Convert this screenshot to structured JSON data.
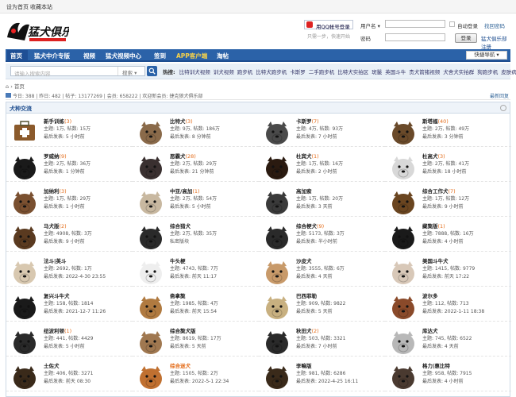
{
  "topbar": {
    "set_home": "设为首页",
    "bookmark": "收藏本站"
  },
  "header": {
    "logo_text": "猛犬俱乐部",
    "qq_login": "用QQ帐号登录",
    "qq_sub": "只需一步，快速开始",
    "username_label": "用户名",
    "password_label": "密码",
    "auto_login": "自动登录",
    "forgot": "找回密码",
    "login_btn": "登录",
    "register": "猛犬俱乐部注册"
  },
  "nav": {
    "items": [
      "首页",
      "猛犬中介专版",
      "视频",
      "猛犬视频中心",
      "签到",
      "APP客户端",
      "淘帖"
    ],
    "quick": "快捷导航"
  },
  "search": {
    "placeholder": "请输入搜索内容",
    "scope": "搜索",
    "hot_label": "热搜:",
    "hot": [
      "比特训犬视频",
      "训犬视频",
      "跑步机",
      "比特犬跑步机",
      "卡斯罗",
      "二手跑步机",
      "比特犬实拍区",
      "斑鬣",
      "英国斗牛",
      "贵犬箭猪视频",
      "犬舍犬实拍群",
      "狗跑步机",
      "皮肤病"
    ]
  },
  "breadcrumb": {
    "home": "首页"
  },
  "stats": {
    "text": "今日: 388 | 昨日: 482 | 帖子: 13177269 | 会员: 658222 | 欢迎新会员: 捷克狼犬俱乐部",
    "latest": "最新回复"
  },
  "forum": {
    "section_title": "犬种交流",
    "boards": [
      {
        "name": "新手训练",
        "today": "(3)",
        "l1": "主题: 1万, 帖数: 15万",
        "l2": "最后发表: 5 小时前",
        "color": "#8b5a2b",
        "icon": "first-aid-icon"
      },
      {
        "name": "比特犬",
        "today": "(3)",
        "l1": "主题: 9万, 帖数: 186万",
        "l2": "最后发表: 8 分钟前",
        "color": "#8a6a4a",
        "icon": "pitbull-photo"
      },
      {
        "name": "卡斯罗",
        "today": "(7)",
        "l1": "主题: 4万, 帖数: 93万",
        "l2": "最后发表: 7 小时前",
        "color": "#4a4a4a",
        "icon": "cane-corso-photo"
      },
      {
        "name": "斯塔福",
        "today": "(40)",
        "l1": "主题: 2万, 帖数: 49万",
        "l2": "最后发表: 3 分钟前",
        "color": "#6a4a2a",
        "icon": "staffy-photo"
      },
      {
        "name": "罗威纳",
        "today": "(9)",
        "l1": "主题: 2万, 帖数: 36万",
        "l2": "最后发表: 1 分钟前",
        "color": "#1a1a1a",
        "icon": "rottweiler-photo"
      },
      {
        "name": "恶霸犬",
        "today": "(28)",
        "l1": "主题: 2万, 帖数: 29万",
        "l2": "最后发表: 21 分钟前",
        "color": "#3a3030",
        "icon": "bully-photo"
      },
      {
        "name": "杜宾犬",
        "today": "(1)",
        "l1": "主题: 1万, 帖数: 16万",
        "l2": "最后发表: 2 小时前",
        "color": "#2a1a10",
        "icon": "doberman-photo"
      },
      {
        "name": "杜高犬",
        "today": "(3)",
        "l1": "主题: 2万, 帖数: 41万",
        "l2": "最后发表: 18 小时前",
        "color": "#d8d8d8",
        "icon": "dogo-photo"
      },
      {
        "name": "加纳利",
        "today": "(3)",
        "l1": "主题: 1万, 帖数: 29万",
        "l2": "最后发表: 1 小时前",
        "color": "#7a5030",
        "icon": "presa-photo"
      },
      {
        "name": "中亚/高加",
        "today": "(1)",
        "l1": "主题: 2万, 帖数: 54万",
        "l2": "最后发表: 5 小时前",
        "color": "#c8b8a0",
        "icon": "caucasian-photo"
      },
      {
        "name": "高加索",
        "today": "",
        "l1": "主题: 1万, 帖数: 20万",
        "l2": "最后发表: 3 天前",
        "color": "#3a3a3a",
        "icon": "caucasian-shepherd-photo"
      },
      {
        "name": "综合工作犬",
        "today": "(7)",
        "l1": "主题: 1万, 帖数: 12万",
        "l2": "最后发表: 9 小时前",
        "color": "#6a4520",
        "icon": "working-dog-photo"
      },
      {
        "name": "马犬版",
        "today": "(2)",
        "l1": "主题: 4908, 帖数: 3万",
        "l2": "最后发表: 9 小时前",
        "color": "#5a3a20",
        "icon": "malinois-photo"
      },
      {
        "name": "综合猎犬",
        "today": "",
        "l1": "主题: 2万, 帖数: 35万",
        "l2": "私密版块",
        "color": "#2a2a2a",
        "icon": "hunting-dog-photo"
      },
      {
        "name": "综合梗犬",
        "today": "(9)",
        "l1": "主题: 5173, 帖数: 3万",
        "l2": "最后发表: 半小时前",
        "color": "#2a2a2a",
        "icon": "terrier-photo"
      },
      {
        "name": "藏獒版",
        "today": "(1)",
        "l1": "主题: 7888, 帖数: 16万",
        "l2": "最后发表: 4 小时前",
        "color": "#1a1a1a",
        "icon": "mastiff-photo"
      },
      {
        "name": "法斗|英斗",
        "today": "",
        "l1": "主题: 2692, 帖数: 1万",
        "l2": "最后发表: 2022-4-30 23:55",
        "color": "#d8c8b0",
        "icon": "bulldog-photo"
      },
      {
        "name": "牛头梗",
        "today": "",
        "l1": "主题: 4743, 帖数: 7万",
        "l2": "最后发表: 前天 11:17",
        "color": "#eeeeee",
        "icon": "bull-terrier-photo"
      },
      {
        "name": "沙皮犬",
        "today": "",
        "l1": "主题: 3555, 帖数: 6万",
        "l2": "最后发表: 4 天前",
        "color": "#c89a6a",
        "icon": "sharpei-photo"
      },
      {
        "name": "美国斗牛犬",
        "today": "",
        "l1": "主题: 1415, 帖数: 9779",
        "l2": "最后发表: 前天 17:22",
        "color": "#d8c8b8",
        "icon": "american-bulldog-photo"
      },
      {
        "name": "复兴斗牛犬",
        "today": "",
        "l1": "主题: 158, 帖数: 1814",
        "l2": "最后发表: 2021-12-7 11:26",
        "color": "#1a1a1a",
        "icon": "olde-bulldog-photo"
      },
      {
        "name": "斋拿獒",
        "today": "",
        "l1": "主题: 1985, 帖数: 4万",
        "l2": "最后发表: 前天 15:54",
        "color": "#b07a40",
        "icon": "boerboel-photo"
      },
      {
        "name": "巴西菲勒",
        "today": "",
        "l1": "主题: 909, 帖数: 9822",
        "l2": "最后发表: 5 天前",
        "color": "#c8b080",
        "icon": "fila-photo"
      },
      {
        "name": "波尔多",
        "today": "",
        "l1": "主题: 112, 帖数: 713",
        "l2": "最后发表: 2022-1-11 18:38",
        "color": "#8a4a2a",
        "icon": "bordeaux-photo"
      },
      {
        "name": "纽波利顿",
        "today": "(1)",
        "l1": "主题: 441, 帖数: 4429",
        "l2": "最后发表: 5 小时前",
        "color": "#2a2a2a",
        "icon": "neapolitan-photo"
      },
      {
        "name": "综合獒犬版",
        "today": "",
        "l1": "主题: 8619, 帖数: 17万",
        "l2": "最后发表: 5 天前",
        "color": "#a07850",
        "icon": "mastiff-group-photo"
      },
      {
        "name": "秋田犬",
        "today": "(2)",
        "l1": "主题: 503, 帖数: 3321",
        "l2": "最后发表: 7 小时前",
        "color": "#2a2a2a",
        "icon": "akita-photo"
      },
      {
        "name": "库达犬",
        "today": "",
        "l1": "主题: 745, 帖数: 6522",
        "l2": "最后发表: 4 天前",
        "color": "#b8b8b8",
        "icon": "kuchi-photo"
      },
      {
        "name": "土佐犬",
        "today": "",
        "l1": "主题: 406, 帖数: 3271",
        "l2": "最后发表: 前天 08:30",
        "color": "#3a2a1a",
        "icon": "tosa-photo"
      },
      {
        "name": "综合迷犬",
        "today": "",
        "l1": "主题: 1505, 帖数: 2万",
        "l2": "最后发表: 2022-5-1 22:34",
        "color": "#c07030",
        "icon": "mixed-dog-photo",
        "orange": true
      },
      {
        "name": "李嘛版",
        "today": "",
        "l1": "主题: 981, 帖数: 6286",
        "l2": "最后发表: 2022-4-25 16:11",
        "color": "#3a2a1a",
        "icon": "lurcher-photo"
      },
      {
        "name": "格力|惠比特",
        "today": "",
        "l1": "主题: 958, 帖数: 7915",
        "l2": "最后发表: 4 小时前",
        "color": "#4a3a30",
        "icon": "greyhound-photo"
      }
    ]
  }
}
